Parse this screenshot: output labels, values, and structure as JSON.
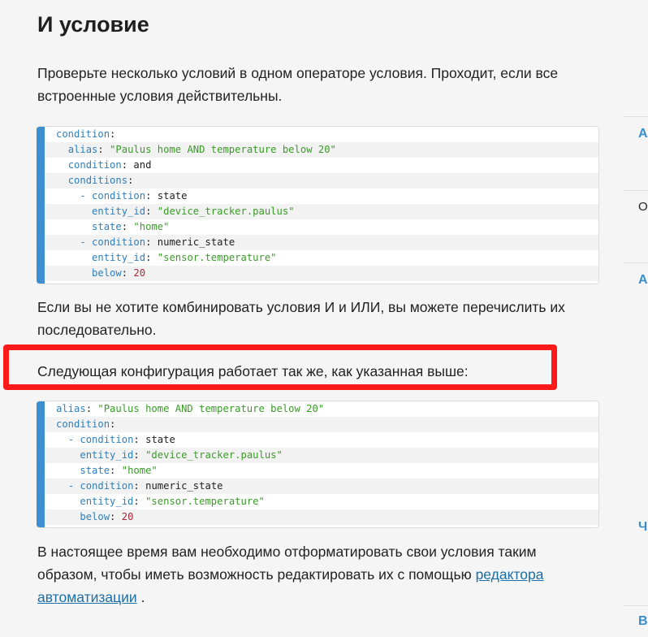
{
  "section": {
    "heading": "И условие",
    "intro": "Проверьте несколько условий в одном операторе условия. Проходит, если все встроенные условия действительны.",
    "para_sequential": "Если вы не хотите комбинировать условия И и ИЛИ, вы можете перечислить их последовательно.",
    "para_highlighted": "Следующая конфигурация работает так же, как указанная выше:",
    "para_footer_text": "В настоящее время вам необходимо отформатировать свои условия таким образом, чтобы иметь возможность редактировать их с помощью ",
    "para_footer_link": "редактора автоматизации",
    "para_footer_end": " ."
  },
  "code_block_1": {
    "l1_key": "condition",
    "l1_sep": ":",
    "l2_key": "alias",
    "l2_sep": ": ",
    "l2_val": "\"Paulus home AND temperature below 20\"",
    "l3_key": "condition",
    "l3_sep": ": ",
    "l3_val": "and",
    "l4_key": "conditions",
    "l4_sep": ":",
    "l5_dash": "- ",
    "l5_key": "condition",
    "l5_sep": ": ",
    "l5_val": "state",
    "l6_key": "entity_id",
    "l6_sep": ": ",
    "l6_val": "\"device_tracker.paulus\"",
    "l7_key": "state",
    "l7_sep": ": ",
    "l7_val": "\"home\"",
    "l8_dash": "- ",
    "l8_key": "condition",
    "l8_sep": ": ",
    "l8_val": "numeric_state",
    "l9_key": "entity_id",
    "l9_sep": ": ",
    "l9_val": "\"sensor.temperature\"",
    "l10_key": "below",
    "l10_sep": ": ",
    "l10_val": "20"
  },
  "code_block_2": {
    "l1_key": "alias",
    "l1_sep": ": ",
    "l1_val": "\"Paulus home AND temperature below 20\"",
    "l2_key": "condition",
    "l2_sep": ":",
    "l3_dash": "- ",
    "l3_key": "condition",
    "l3_sep": ": ",
    "l3_val": "state",
    "l4_key": "entity_id",
    "l4_sep": ": ",
    "l4_val": "\"device_tracker.paulus\"",
    "l5_key": "state",
    "l5_sep": ": ",
    "l5_val": "\"home\"",
    "l6_dash": "- ",
    "l6_key": "condition",
    "l6_sep": ": ",
    "l6_val": "numeric_state",
    "l7_key": "entity_id",
    "l7_sep": ": ",
    "l7_val": "\"sensor.temperature\"",
    "l8_key": "below",
    "l8_sep": ": ",
    "l8_val": "20"
  },
  "sidebar": {
    "item1": "А",
    "item2": "О",
    "item3": "А",
    "item4": "Ч",
    "item5": "В"
  },
  "colors": {
    "accent": "#3d8fd1",
    "highlight_box": "#ff1a1a",
    "link": "#1b6ea6",
    "yaml_key": "#2f7fba",
    "yaml_string": "#3a9a28",
    "yaml_number": "#b0283a"
  }
}
